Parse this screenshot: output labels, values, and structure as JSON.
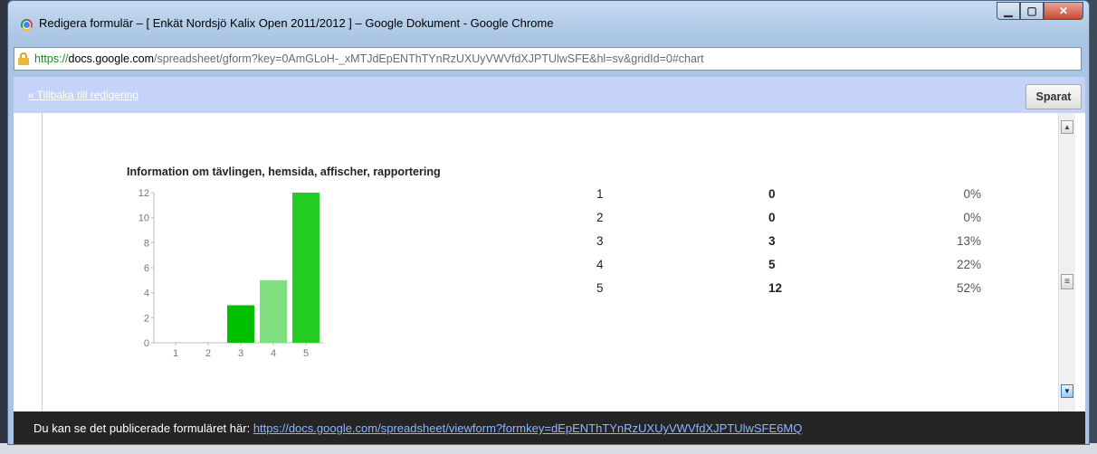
{
  "window": {
    "title": "Redigera formulär – [ Enkät Nordsjö Kalix Open 2011/2012 ] – Google Dokument - Google Chrome"
  },
  "address": {
    "scheme": "https://",
    "host": "docs.google.com",
    "path": "/spreadsheet/gform?key=0AmGLoH-_xMTJdEpENThTYnRzUXUyVWVfdXJPTUlwSFE&hl=sv&gridId=0#chart"
  },
  "toolbar": {
    "back_label": "« Tillbaka till redigering",
    "save_label": "Sparat"
  },
  "chart_data": {
    "type": "bar",
    "title": "Information om tävlingen, hemsida, affischer, rapportering",
    "categories": [
      "1",
      "2",
      "3",
      "4",
      "5"
    ],
    "values": [
      0,
      0,
      3,
      5,
      12
    ],
    "yticks": [
      "0",
      "2",
      "4",
      "6",
      "8",
      "10",
      "12"
    ],
    "ylim": [
      0,
      12
    ],
    "bar_colors": [
      "#00c000",
      "#00c000",
      "#00c000",
      "#80e080",
      "#22cc22"
    ]
  },
  "stats": [
    {
      "label": "1",
      "count": "0",
      "pct": "0%"
    },
    {
      "label": "2",
      "count": "0",
      "pct": "0%"
    },
    {
      "label": "3",
      "count": "3",
      "pct": "13%"
    },
    {
      "label": "4",
      "count": "5",
      "pct": "22%"
    },
    {
      "label": "5",
      "count": "12",
      "pct": "52%"
    }
  ],
  "footer": {
    "text": "Du kan se det publicerade formuläret här: ",
    "link": "https://docs.google.com/spreadsheet/viewform?formkey=dEpENThTYnRzUXUyVWVfdXJPTUlwSFE6MQ"
  }
}
